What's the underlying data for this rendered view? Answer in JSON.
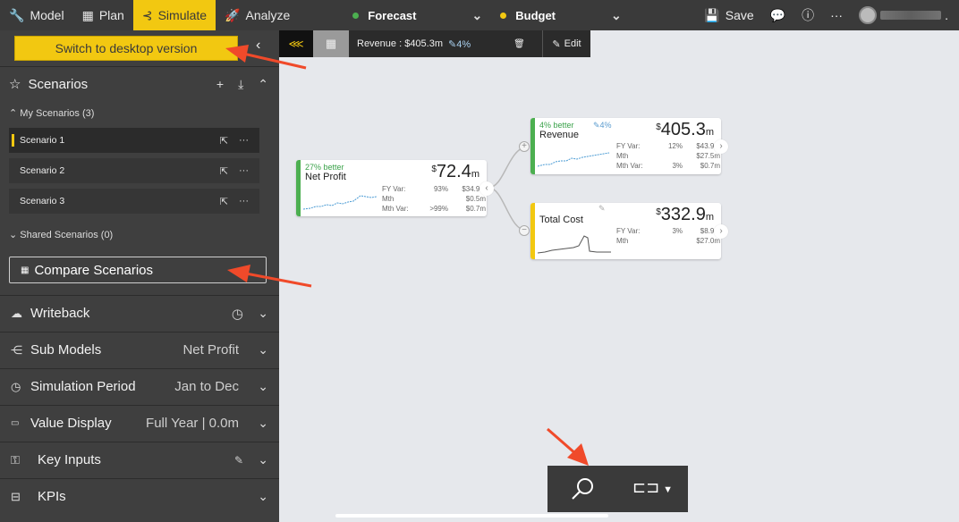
{
  "topbar": {
    "tabs": [
      {
        "label": "Model",
        "icon": "wrench-icon"
      },
      {
        "label": "Plan",
        "icon": "grid-icon"
      },
      {
        "label": "Simulate",
        "icon": "simulate-icon"
      },
      {
        "label": "Analyze",
        "icon": "rocket-icon"
      }
    ],
    "forecast": {
      "label": "Forecast",
      "color": "#4caf50"
    },
    "budget": {
      "label": "Budget",
      "color": "#f2c811"
    },
    "save_label": "Save",
    "more": "···",
    "user_suffix": "."
  },
  "panel": {
    "desktop_button": "Switch to desktop version",
    "scenarios_title": "Scenarios",
    "my_scenarios": "My Scenarios (3)",
    "scenario_items": [
      "Scenario 1",
      "Scenario 2",
      "Scenario 3"
    ],
    "shared_scenarios": "Shared Scenarios (0)",
    "compare_button": "Compare Scenarios",
    "sections": [
      {
        "label": "Writeback",
        "value": "",
        "icon": "cloud-icon"
      },
      {
        "label": "Sub Models",
        "value": "Net Profit",
        "icon": "submodel-icon"
      },
      {
        "label": "Simulation Period",
        "value": "Jan to Dec",
        "icon": "clock-icon"
      },
      {
        "label": "Value Display",
        "value": "Full Year | 0.0m",
        "icon": "value-display-icon"
      },
      {
        "label": "Key Inputs",
        "value": "",
        "icon": "key-icon"
      },
      {
        "label": "KPIs",
        "value": "",
        "icon": "kpi-icon"
      }
    ]
  },
  "canvas_toolbar": {
    "node_label": "Revenue : $405.3m",
    "node_pct": "4%",
    "edit_label": "Edit"
  },
  "cards": {
    "net_profit": {
      "better": "27% better",
      "name": "Net Profit",
      "value": "72.4",
      "currency": "$",
      "unit": "m",
      "rows": [
        [
          "FY Var:",
          "93%",
          "$34.9m"
        ],
        [
          "Mth",
          "",
          "$0.5m"
        ],
        [
          "Mth Var:",
          ">99%",
          "$0.7m"
        ]
      ]
    },
    "revenue": {
      "better": "4% better",
      "pct": "4%",
      "name": "Revenue",
      "value": "405.3",
      "currency": "$",
      "unit": "m",
      "rows": [
        [
          "FY Var:",
          "12%",
          "$43.9m"
        ],
        [
          "Mth",
          "",
          "$27.5m"
        ],
        [
          "Mth Var:",
          "3%",
          "$0.7m"
        ]
      ]
    },
    "total_cost": {
      "name": "Total Cost",
      "value": "332.9",
      "currency": "$",
      "unit": "m",
      "rows": [
        [
          "FY Var:",
          "3%",
          "$8.9m"
        ],
        [
          "Mth",
          "",
          "$27.0m"
        ]
      ]
    }
  },
  "colors": {
    "accent": "#f2c811",
    "green": "#4caf50",
    "annotation": "#f04a2a"
  }
}
